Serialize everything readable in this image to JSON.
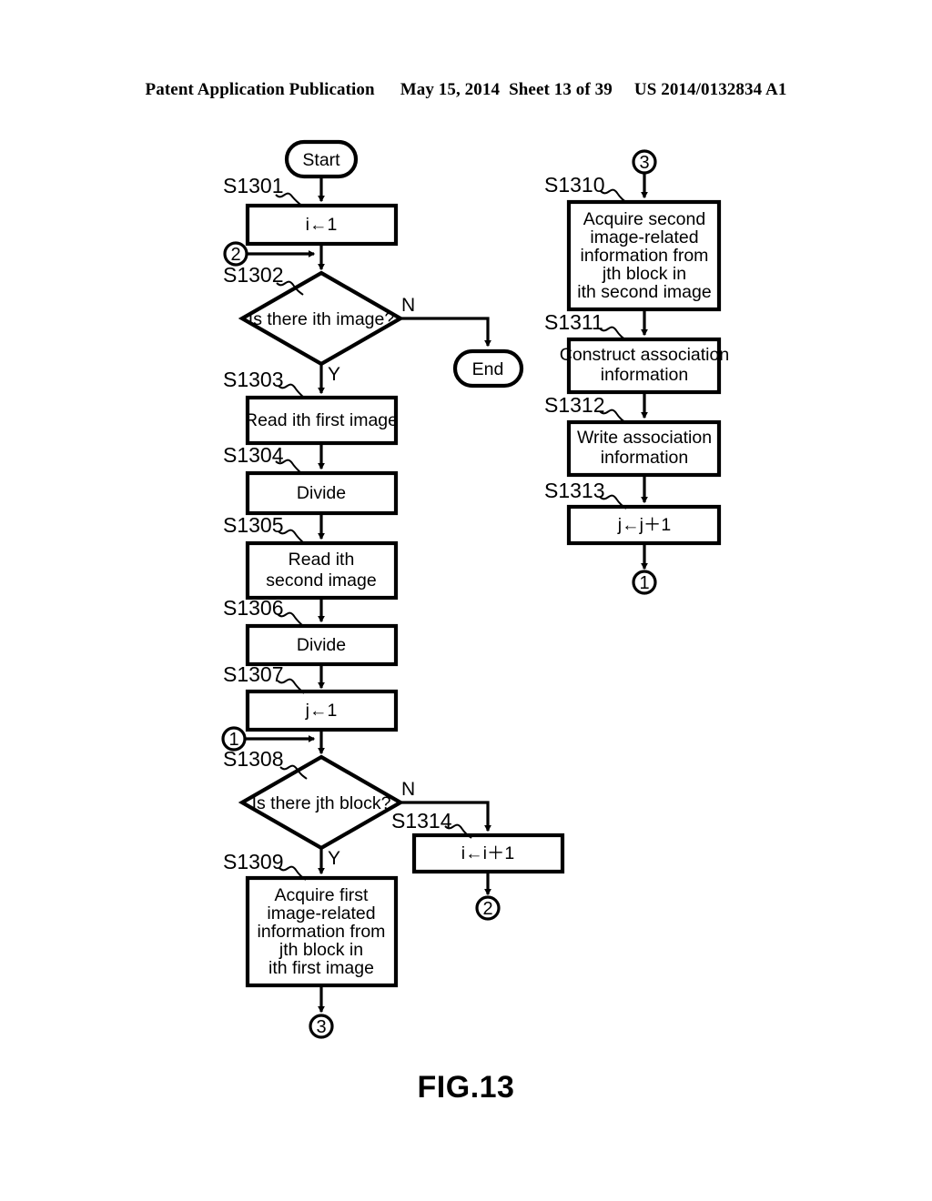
{
  "header": {
    "publication": "Patent Application Publication",
    "date": "May 15, 2014",
    "sheet": "Sheet 13 of 39",
    "patent_number": "US 2014/0132834 A1"
  },
  "figure": {
    "caption": "FIG.13"
  },
  "flowchart": {
    "terminators": {
      "start": "Start",
      "end": "End"
    },
    "branch_labels": {
      "yes": "Y",
      "no": "N"
    },
    "connectors": {
      "one": "1",
      "two": "2",
      "three": "3"
    },
    "steps": [
      {
        "id": "S1301",
        "label": "S1301",
        "text": "i←1",
        "type": "process"
      },
      {
        "id": "S1302",
        "label": "S1302",
        "text": "Is there ith image?",
        "type": "decision"
      },
      {
        "id": "S1303",
        "label": "S1303",
        "text": "Read ith first image",
        "type": "process"
      },
      {
        "id": "S1304",
        "label": "S1304",
        "text": "Divide",
        "type": "process"
      },
      {
        "id": "S1305",
        "label": "S1305",
        "text": "Read ith\nsecond image",
        "type": "process"
      },
      {
        "id": "S1306",
        "label": "S1306",
        "text": "Divide",
        "type": "process"
      },
      {
        "id": "S1307",
        "label": "S1307",
        "text": "j←1",
        "type": "process"
      },
      {
        "id": "S1308",
        "label": "S1308",
        "text": "Is there jth block?",
        "type": "decision"
      },
      {
        "id": "S1309",
        "label": "S1309",
        "text": "Acquire first\nimage-related\ninformation from\njth block in\nith first image",
        "type": "process"
      },
      {
        "id": "S1310",
        "label": "S1310",
        "text": "Acquire second\nimage-related\ninformation from\njth block in\nith second image",
        "type": "process"
      },
      {
        "id": "S1311",
        "label": "S1311",
        "text": "Construct association\ninformation",
        "type": "process"
      },
      {
        "id": "S1312",
        "label": "S1312",
        "text": "Write association\ninformation",
        "type": "process"
      },
      {
        "id": "S1313",
        "label": "S1313",
        "text": "j←j＋1",
        "type": "process"
      },
      {
        "id": "S1314",
        "label": "S1314",
        "text": "i←i＋1",
        "type": "process"
      }
    ],
    "step_lines": {
      "S1301": [
        "i←1"
      ],
      "S1303": [
        "Read ith first image"
      ],
      "S1304": [
        "Divide"
      ],
      "S1305": [
        "Read ith",
        "second image"
      ],
      "S1306": [
        "Divide"
      ],
      "S1307": [
        "j←1"
      ],
      "S1309": [
        "Acquire first",
        "image-related",
        "information from",
        "jth block in",
        "ith first image"
      ],
      "S1310": [
        "Acquire second",
        "image-related",
        "information from",
        "jth block in",
        "ith second image"
      ],
      "S1311": [
        "Construct association",
        "information"
      ],
      "S1312": [
        "Write association",
        "information"
      ],
      "S1313": [
        "j←j＋1"
      ],
      "S1314": [
        "i←i＋1"
      ]
    }
  }
}
